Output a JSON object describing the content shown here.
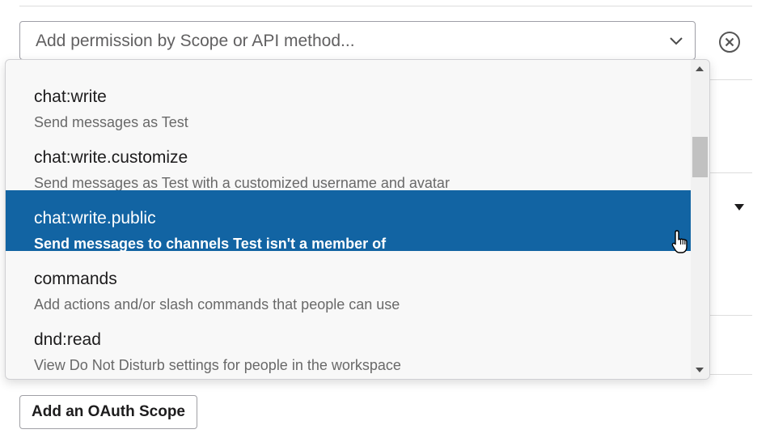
{
  "select": {
    "placeholder": "Add permission by Scope or API method..."
  },
  "icons": {
    "chevron": "chevron-down-icon",
    "clear": "clear-circle-x-icon",
    "caret": "caret-down-icon",
    "cursor": "pointer-hand-cursor-icon"
  },
  "dropdown": {
    "options": [
      {
        "name": "chat:write",
        "description": "Send messages as Test"
      },
      {
        "name": "chat:write.customize",
        "description": "Send messages as Test with a customized username and avatar"
      },
      {
        "name": "chat:write.public",
        "description": "Send messages to channels Test isn't a member of",
        "selected": true
      },
      {
        "name": "commands",
        "description": "Add actions and/or slash commands that people can use"
      },
      {
        "name": "dnd:read",
        "description": "View Do Not Disturb settings for people in the workspace"
      }
    ],
    "scroll_position": 0.25
  },
  "footer": {
    "add_scope_label": "Add an OAuth Scope"
  },
  "colors": {
    "selected_bg": "#1264a3",
    "dropdown_bg": "#f8f8f8",
    "text_primary": "#1d1c1d",
    "text_secondary": "#696969"
  }
}
